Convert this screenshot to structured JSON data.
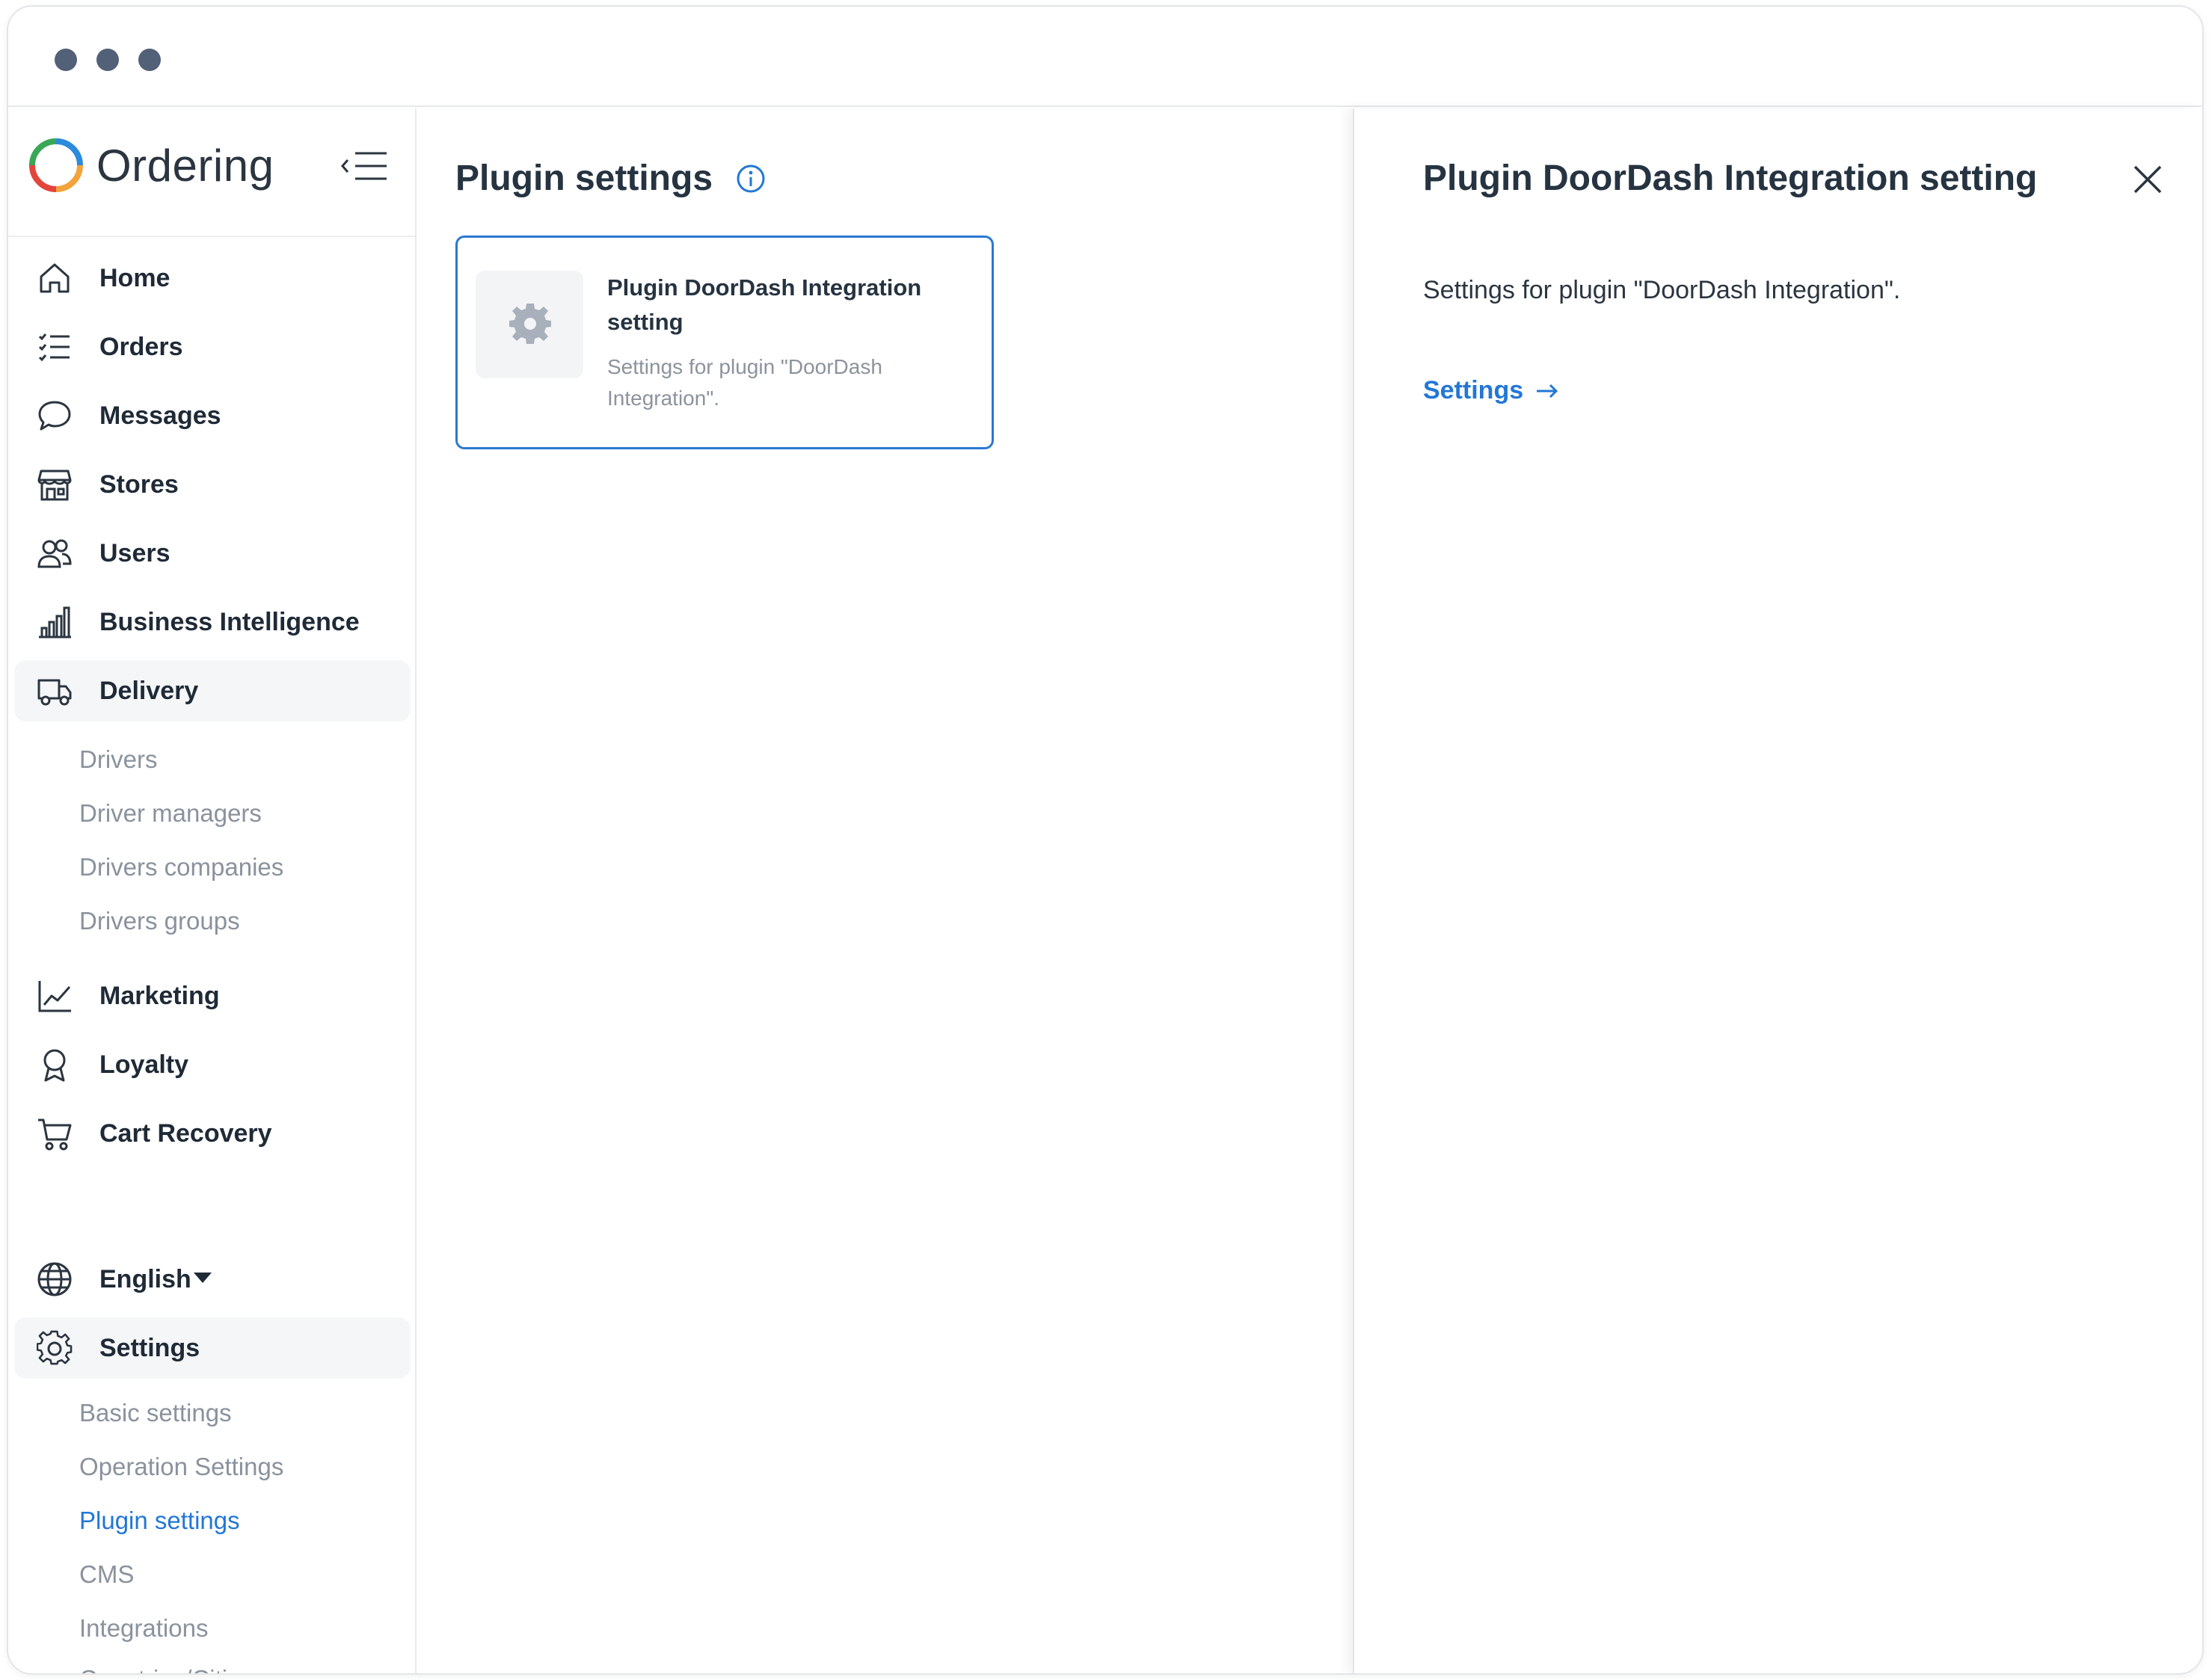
{
  "window": {
    "controls": [
      "close",
      "minimize",
      "maximize"
    ]
  },
  "brand": {
    "name": "Ordering",
    "logo_icon": "ordering-ring-logo"
  },
  "sidebar": {
    "items": [
      {
        "label": "Home",
        "icon": "home-icon"
      },
      {
        "label": "Orders",
        "icon": "list-icon"
      },
      {
        "label": "Messages",
        "icon": "chat-bubble-icon"
      },
      {
        "label": "Stores",
        "icon": "storefront-icon"
      },
      {
        "label": "Users",
        "icon": "users-icon"
      },
      {
        "label": "Business Intelligence",
        "icon": "bar-chart-icon"
      },
      {
        "label": "Delivery",
        "icon": "truck-icon",
        "active": true
      },
      {
        "label": "Marketing",
        "icon": "line-chart-icon"
      },
      {
        "label": "Loyalty",
        "icon": "award-icon"
      },
      {
        "label": "Cart Recovery",
        "icon": "cart-icon"
      }
    ],
    "delivery_sub": [
      "Drivers",
      "Driver managers",
      "Drivers companies",
      "Drivers groups"
    ],
    "language": {
      "label": "English",
      "icon": "globe-icon"
    },
    "settings": {
      "label": "Settings",
      "icon": "gear-icon"
    },
    "settings_sub": [
      "Basic settings",
      "Operation Settings",
      "Plugin settings",
      "CMS",
      "Integrations",
      "Countries/Cities"
    ],
    "settings_sub_active": "Plugin settings"
  },
  "main": {
    "title": "Plugin settings",
    "card": {
      "title": "Plugin DoorDash Integration setting",
      "description": "Settings for plugin \"DoorDash Integration\"."
    }
  },
  "panel": {
    "title": "Plugin DoorDash Integration setting",
    "description": "Settings for plugin \"DoorDash Integration\".",
    "link_label": "Settings"
  },
  "colors": {
    "accent": "#2277d6",
    "text": "#1f2a37",
    "muted": "#8a929d"
  }
}
